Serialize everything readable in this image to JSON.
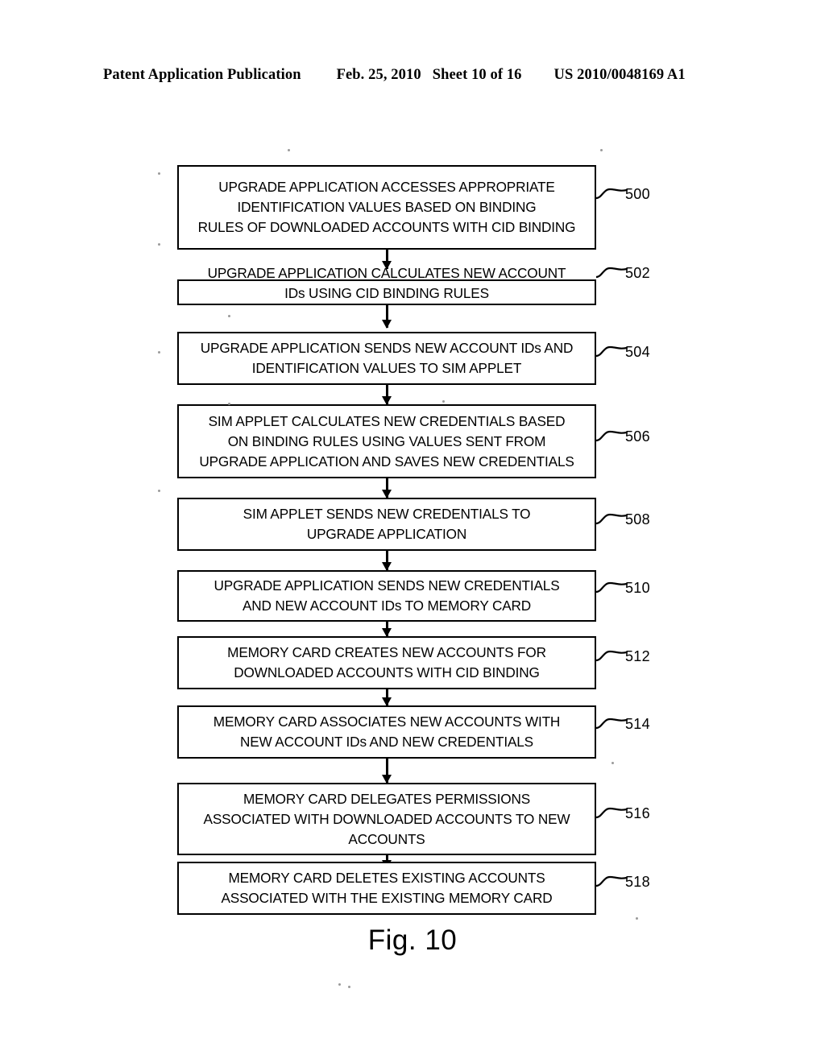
{
  "header": {
    "publication": "Patent Application Publication",
    "date": "Feb. 25, 2010",
    "sheet": "Sheet 10 of 16",
    "patent_number": "US 2010/0048169 A1"
  },
  "figure": {
    "caption": "Fig. 10",
    "type": "flowchart",
    "steps": [
      {
        "ref": "500",
        "text": "UPGRADE APPLICATION ACCESSES APPROPRIATE\nIDENTIFICATION VALUES BASED ON BINDING\nRULES OF DOWNLOADED ACCOUNTS WITH CID BINDING"
      },
      {
        "ref": "502",
        "text": "UPGRADE APPLICATION CALCULATES NEW ACCOUNT\nIDs USING CID BINDING RULES"
      },
      {
        "ref": "504",
        "text": "UPGRADE APPLICATION SENDS NEW ACCOUNT IDs AND\nIDENTIFICATION VALUES TO SIM APPLET"
      },
      {
        "ref": "506",
        "text": "SIM APPLET CALCULATES NEW CREDENTIALS BASED\nON BINDING RULES USING VALUES SENT FROM\nUPGRADE APPLICATION AND SAVES NEW CREDENTIALS"
      },
      {
        "ref": "508",
        "text": "SIM APPLET SENDS NEW CREDENTIALS TO\nUPGRADE APPLICATION"
      },
      {
        "ref": "510",
        "text": "UPGRADE APPLICATION SENDS NEW CREDENTIALS\nAND NEW ACCOUNT IDs TO MEMORY CARD"
      },
      {
        "ref": "512",
        "text": "MEMORY CARD CREATES NEW ACCOUNTS FOR\nDOWNLOADED ACCOUNTS WITH CID BINDING"
      },
      {
        "ref": "514",
        "text": "MEMORY CARD ASSOCIATES NEW ACCOUNTS WITH\nNEW ACCOUNT IDs AND NEW CREDENTIALS"
      },
      {
        "ref": "516",
        "text": "MEMORY CARD DELEGATES PERMISSIONS\nASSOCIATED WITH DOWNLOADED ACCOUNTS TO NEW\nACCOUNTS"
      },
      {
        "ref": "518",
        "text": "MEMORY CARD DELETES EXISTING ACCOUNTS\nASSOCIATED WITH THE EXISTING MEMORY CARD"
      }
    ]
  },
  "colors": {
    "ink": "#000000",
    "paper": "#ffffff"
  }
}
